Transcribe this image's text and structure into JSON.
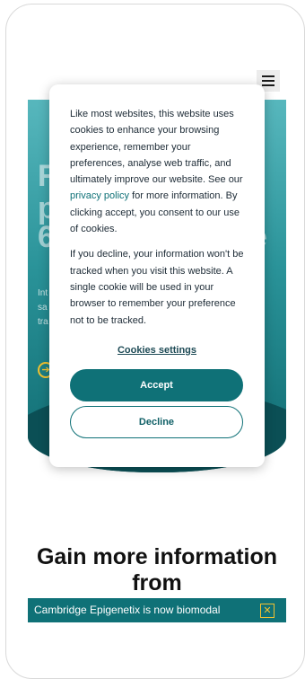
{
  "header": {
    "menu_icon": "hamburger-menu-icon"
  },
  "hero": {
    "lines_large": [
      "R",
      "p",
      "6",
      "e"
    ],
    "lines_small": [
      "Int",
      "sa",
      "tra"
    ],
    "cta_icon": "arrow-right-circle-icon"
  },
  "cookie_dialog": {
    "paragraph1_before_link": "Like most websites, this website uses cookies to enhance your browsing experience, remember your preferences, analyse web traffic, and ultimately improve our website. See our ",
    "privacy_link": "privacy policy",
    "paragraph1_after_link": " for more information. By clicking accept, you consent to our use of cookies.",
    "paragraph2": "If you decline, your information won't be tracked when you visit this website. A single cookie will be used in your browser to remember your preference not to be tracked.",
    "settings_label": "Cookies settings",
    "accept_label": "Accept",
    "decline_label": "Decline"
  },
  "section": {
    "heading": "Gain more information from"
  },
  "banner": {
    "text": "Cambridge Epigenetix is now biomodal",
    "close_icon": "close-icon",
    "accent_color": "#f2c230"
  },
  "colors": {
    "brand_teal": "#0f7177",
    "text_dark": "#1d2b36"
  }
}
